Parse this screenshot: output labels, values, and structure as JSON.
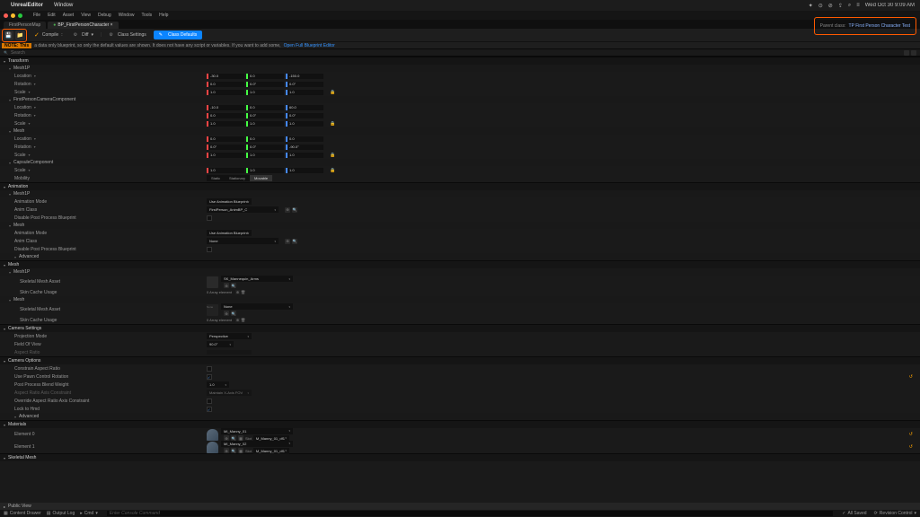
{
  "mac": {
    "app": "UnrealEditor",
    "window": "Window",
    "clock": "Wed Oct 30  9:09 AM"
  },
  "ue_menu": [
    "File",
    "Edit",
    "Asset",
    "View",
    "Debug",
    "Window",
    "Tools",
    "Help"
  ],
  "tabs": [
    {
      "label": "FirstPersonMap"
    },
    {
      "label": "BP_FirstPersonCharacter",
      "active": true
    }
  ],
  "toolbar": {
    "compile": "Compile",
    "diff": "Diff",
    "class_settings": "Class Settings",
    "class_defaults": "Class Defaults",
    "parent_label": "Parent class:",
    "parent_class": "TP First Person Character Test"
  },
  "note": {
    "badge": "NOTE: This",
    "text": "a data only blueprint, so only the default values are shown.  It does not have any script or variables.  If you want to add some,",
    "link": "Open Full Blueprint Editor"
  },
  "search_placeholder": "Search",
  "cats": {
    "transform": "Transform",
    "mesh1p": "Mesh1P",
    "fpcc": "FirstPersonCameraComponent",
    "mesh": "Mesh",
    "capsule": "CapsuleComponent",
    "anim": "Animation",
    "adv": "Advanced",
    "meshcat": "Mesh",
    "camset": "Camera Settings",
    "camopt": "Camera Options",
    "materials": "Materials",
    "skel": "Skeletal Mesh"
  },
  "rows": {
    "location": "Location",
    "rotation": "Rotation",
    "scale": "Scale",
    "mobility": "Mobility",
    "animmode": "Animation Mode",
    "animclass": "Anim Class",
    "disablepp": "Disable Post Process Blueprint",
    "skelasset": "Skeletal Mesh Asset",
    "skincache": "Skin Cache Usage",
    "projmode": "Projection Mode",
    "fov": "Field Of View",
    "ar": "Aspect Ratio",
    "constrainar": "Constrain Aspect Ratio",
    "usepawn": "Use Pawn Control Rotation",
    "ppweight": "Post Process Blend Weight",
    "axiscon": "Aspect Ratio Axis Constraint",
    "overridear": "Override Aspect Ratio Axis Constraint",
    "locktohmd": "Lock to Hmd",
    "el0": "Element 0",
    "el1": "Element 1"
  },
  "vals": {
    "loc1": [
      "-30.0",
      "0.0",
      "-150.0"
    ],
    "rot1": [
      "0.0",
      "0.0°",
      "0.0°"
    ],
    "scl1": [
      "1.0",
      "1.0",
      "1.0"
    ],
    "loc2": [
      "-10.0",
      "0.0",
      "60.0"
    ],
    "rot2": [
      "0.0",
      "0.0°",
      "0.0°"
    ],
    "scl2": [
      "1.0",
      "1.0",
      "1.0"
    ],
    "loc3": [
      "0.0",
      "0.0",
      "0.0"
    ],
    "rot3": [
      "0.0°",
      "0.0°",
      "-90.0°"
    ],
    "scl3": [
      "1.0",
      "1.0",
      "1.0"
    ],
    "scl4": [
      "1.0",
      "1.0",
      "1.0"
    ],
    "mobility": [
      "Static",
      "Stationary",
      "Movable"
    ],
    "animmode": "Use Animation Blueprint",
    "animclass1": "FirstPerson_AnimBP_C",
    "animclass2": "None",
    "skel1": "SK_Mannequin_Arms",
    "skel2": "None",
    "arr": "0 Array element",
    "proj": "Perspective",
    "fov": "90.0°",
    "ppw": "1.0",
    "axiscon": "Maintain X-Axis FOV",
    "mat0": "MI_Manny_01",
    "mat1": "MI_Manny_02",
    "matext": "M_Manny_01_df1"
  },
  "footer": {
    "public": "Public View",
    "drawer": "Content Drawer",
    "output": "Output Log",
    "cmd": "Cmd",
    "cmdhint": "Enter Console Command",
    "saved": "All Saved",
    "revision": "Revision Control"
  }
}
